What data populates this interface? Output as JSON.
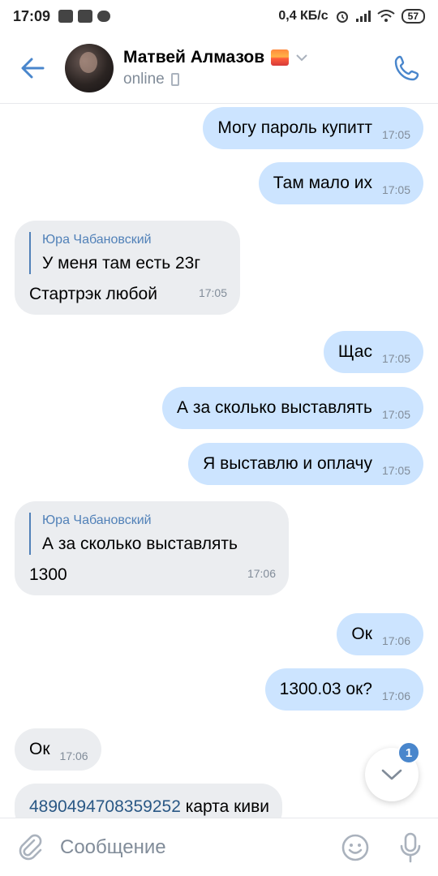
{
  "status_bar": {
    "time": "17:09",
    "speed": "0,4 КБ/с",
    "battery": "57"
  },
  "header": {
    "name": "Матвей Алмазов",
    "status": "online"
  },
  "messages": [
    {
      "dir": "out",
      "text": "Могу пароль купитт",
      "time": "17:05"
    },
    {
      "dir": "out",
      "text": "Там мало их",
      "time": "17:05"
    },
    {
      "dir": "in",
      "quote_author": "Юра Чабановский",
      "quote_text": "У меня там есть 23г",
      "text": "Стартрэк любой",
      "time": "17:05"
    },
    {
      "dir": "out",
      "text": "Щас",
      "time": "17:05"
    },
    {
      "dir": "out",
      "text": "А за сколько выставлять",
      "time": "17:05"
    },
    {
      "dir": "out",
      "text": "Я выставлю и оплачу",
      "time": "17:05"
    },
    {
      "dir": "in",
      "quote_author": "Юра Чабановский",
      "quote_text": "А за сколько выставлять",
      "text": "1300",
      "time": "17:06"
    },
    {
      "dir": "out",
      "text": "Ок",
      "time": "17:06"
    },
    {
      "dir": "out",
      "text": "1300.03 ок?",
      "time": "17:06"
    },
    {
      "dir": "in",
      "text": "Ок",
      "time": "17:06"
    },
    {
      "dir": "in",
      "link": "4890494708359252",
      "text": " карта киви"
    }
  ],
  "unread_badge": "1",
  "composer": {
    "placeholder": "Сообщение"
  },
  "colors": {
    "accent": "#4986cc",
    "outgoing_bubble": "#cce4ff",
    "incoming_bubble": "#ebedf0",
    "secondary_text": "#818c99"
  }
}
